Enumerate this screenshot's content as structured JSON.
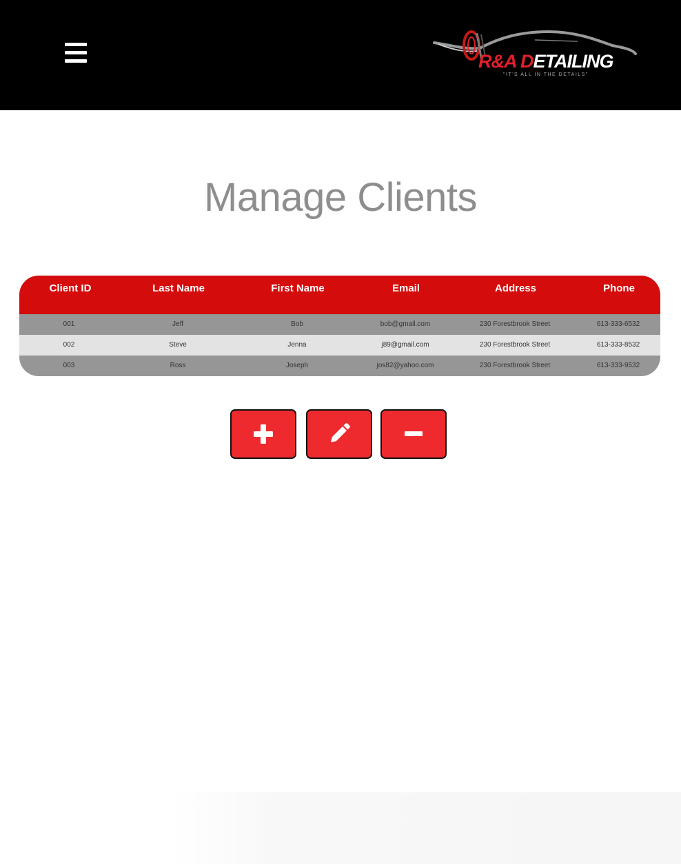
{
  "header": {
    "logo": {
      "brand_ra": "R&A ",
      "brand_d": "D",
      "brand_rest": "ETAILING",
      "tagline": "\"IT'S ALL IN THE DETAILS\""
    },
    "menu_icon": "hamburger-menu-icon"
  },
  "main": {
    "title": "Manage Clients",
    "table": {
      "columns": [
        "Client ID",
        "Last Name",
        "First Name",
        "Email",
        "Address",
        "Phone"
      ],
      "rows": [
        [
          "001",
          "Jeff",
          "Bob",
          "bob@gmail.com",
          "230 Forestbrook Street",
          "613-333-6532"
        ],
        [
          "002",
          "Steve",
          "Jenna",
          "j89@gmail.com",
          "230 Forestbrook Street",
          "613-333-8532"
        ],
        [
          "003",
          "Ross",
          "Joseph",
          "jos82@yahoo.com",
          "230 Forestbrook Street",
          "613-333-9532"
        ]
      ]
    },
    "actions": [
      {
        "name": "add-button",
        "icon": "plus-icon"
      },
      {
        "name": "edit-button",
        "icon": "pencil-icon"
      },
      {
        "name": "remove-button",
        "icon": "minus-icon"
      }
    ]
  },
  "colors": {
    "header_bg": "#000000",
    "accent_red": "#d40c0c",
    "button_red": "#ee2a2e",
    "title_gray": "#8e8e8e",
    "row_dark": "#969696",
    "row_light": "#e3e3e3"
  }
}
